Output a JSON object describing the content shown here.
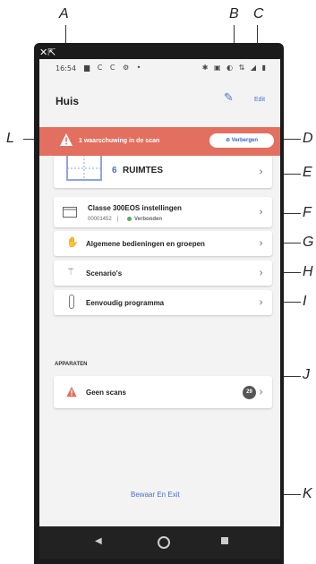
{
  "callouts": {
    "A": "A",
    "B": "B",
    "C": "C",
    "D": "D",
    "E": "E",
    "F": "F",
    "G": "G",
    "H": "H",
    "I": "I",
    "J": "J",
    "K": "K",
    "L": "L"
  },
  "statusbar": {
    "time": "16:54",
    "left_icons": "▆ C C ⚙ •",
    "right_icons": "✱ ▣ ◐ ⇅ ◢ ▮"
  },
  "header": {
    "title": "Huis",
    "edit_label": "Edit",
    "edit_icon": "pencil-icon"
  },
  "banner": {
    "text": "1 waarschuwing in de scan",
    "hide_label": "Verbergen",
    "color": "#e26f5f"
  },
  "rooms": {
    "count": "6",
    "label": "RUIMTES"
  },
  "classe": {
    "title": "Classe 300EOS instellingen",
    "id": "00001452",
    "separator": "|",
    "status": "Verbonden",
    "status_color": "#5aae5a"
  },
  "menu": [
    {
      "label": "Algemene bedieningen en groepen",
      "icon": "hand-icon"
    },
    {
      "label": "Scenario's",
      "icon": "wand-icon"
    },
    {
      "label": "Eenvoudig programma",
      "icon": "thermometer-icon"
    }
  ],
  "devices": {
    "section_title": "APPARATEN",
    "item_label": "Geen scans",
    "badge": "29"
  },
  "footer": {
    "save_exit": "Bewaar En Exit"
  },
  "colors": {
    "accent": "#4a6fd0"
  }
}
